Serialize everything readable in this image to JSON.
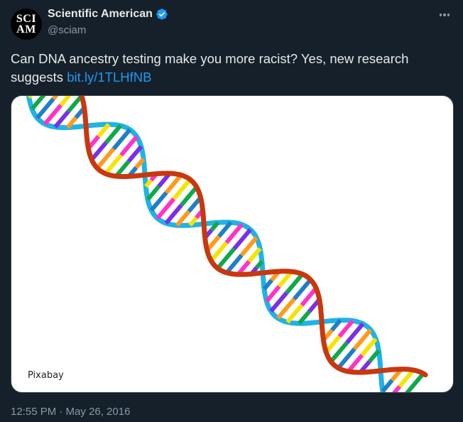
{
  "account": {
    "avatar_lines": [
      "SCI",
      "AM"
    ],
    "name": "Scientific American",
    "handle": "@sciam",
    "verified": true
  },
  "tweet": {
    "text": "Can DNA ancestry testing make you more racist? Yes, new research suggests ",
    "link_text": "bit.ly/1TLHfNB",
    "timestamp": "12:55 PM · May 26, 2016"
  },
  "media": {
    "credit": "Pixabay",
    "strand_colors": {
      "blue_strand": "#1fb3e6",
      "red_strand": "#c8380e"
    },
    "rung_colors": [
      "#f5e400",
      "#10a84a",
      "#1f7fc7",
      "#ff33c7",
      "#7b2fe6",
      "#ff9a1a"
    ]
  },
  "colors": {
    "background": "#15202b",
    "link": "#1d9bf0",
    "verified_badge": "#1d9bf0",
    "muted_text": "#8b98a5"
  },
  "icons": [
    "verified-badge-icon",
    "more-options-icon"
  ]
}
